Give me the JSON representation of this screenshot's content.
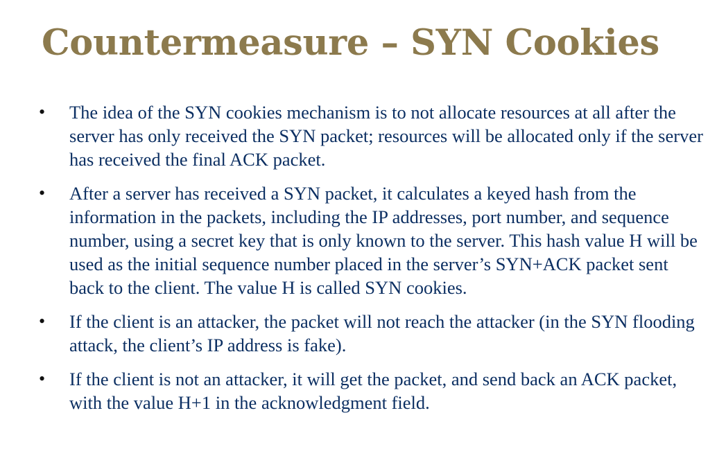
{
  "slide": {
    "title": "Countermeasure – SYN Cookies",
    "bullet_symbol": "•",
    "bullets": [
      "The idea of the SYN cookies mechanism is to not allocate resources at all after the server has only received the SYN packet; resources will be allocated only if the server has received the final ACK packet.",
      "After a server has received a SYN packet, it calculates a keyed hash from the information in the packets, including the IP addresses, port number, and sequence number, using a secret key that is only known to the server. This hash value H will be used as the initial sequence number placed in the server’s SYN+ACK packet sent back to the client. The value H is called SYN cookies.",
      "If the client is an attacker, the packet will not reach the attacker (in the SYN flooding attack, the client’s IP address is fake).",
      "If the client is not an attacker, it will get the packet, and send back an ACK packet, with the value H+1 in the acknowledgment field."
    ]
  },
  "colors": {
    "title": "#8c7a4d",
    "body_text": "#0c2f62",
    "bullet": "#111111",
    "background": "#ffffff"
  }
}
